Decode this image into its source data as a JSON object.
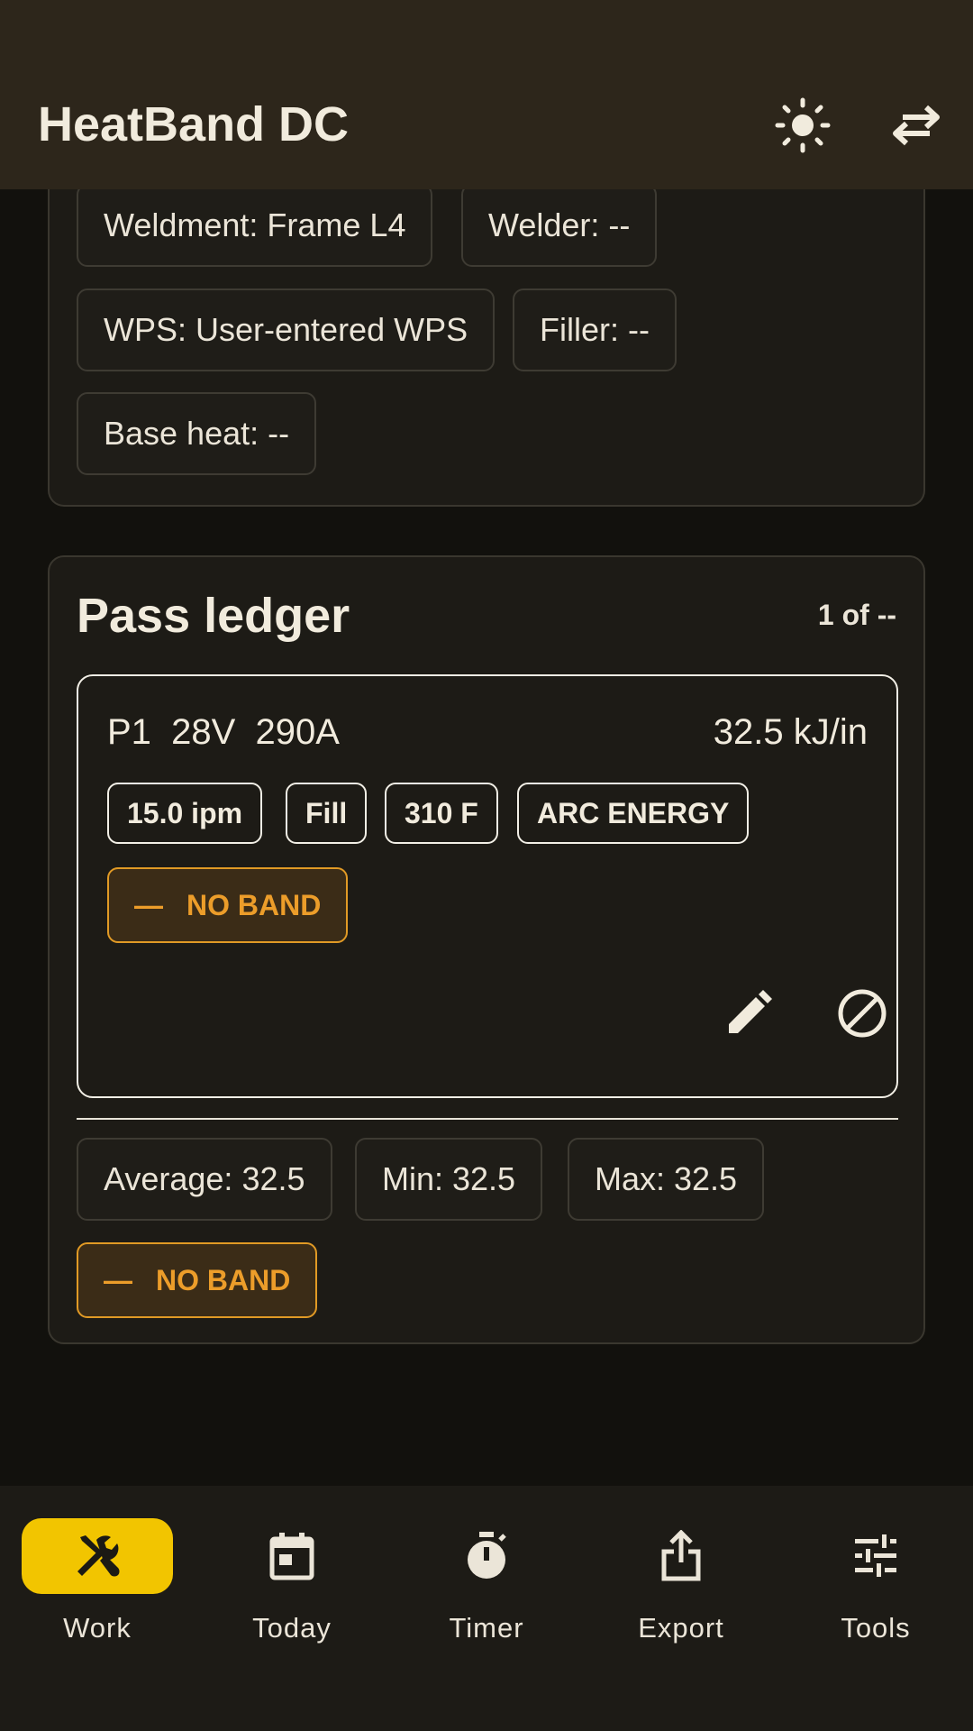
{
  "appbar": {
    "title": "HeatBand DC",
    "icons": [
      "sun-icon",
      "swap-icon"
    ]
  },
  "details": {
    "chips": [
      "Weldment: Frame L4",
      "Welder: --",
      "WPS: User-entered WPS",
      "Filler: --",
      "Base heat: --"
    ]
  },
  "ledger": {
    "title": "Pass ledger",
    "count": "1 of --",
    "pass": {
      "label": "P1  28V  290A",
      "energy": "32.5 kJ/in",
      "tags": [
        "15.0 ipm",
        "Fill",
        "310 F",
        "ARC ENERGY"
      ],
      "band": "NO BAND",
      "band_dash": "—",
      "actions": [
        "edit-icon",
        "void-icon"
      ]
    },
    "stats": {
      "average": "Average: 32.5",
      "min": "Min: 32.5",
      "max": "Max: 32.5",
      "band": "NO BAND",
      "band_dash": "—"
    }
  },
  "nav": {
    "items": [
      {
        "label": "Work",
        "icon": "tools-icon",
        "active": true
      },
      {
        "label": "Today",
        "icon": "calendar-icon",
        "active": false
      },
      {
        "label": "Timer",
        "icon": "timer-icon",
        "active": false
      },
      {
        "label": "Export",
        "icon": "share-icon",
        "active": false
      },
      {
        "label": "Tools",
        "icon": "sliders-icon",
        "active": false
      }
    ]
  },
  "colors": {
    "appbar_bg": "#2d261b",
    "accent": "#f2c500",
    "band_orange": "#ec9d2a"
  }
}
